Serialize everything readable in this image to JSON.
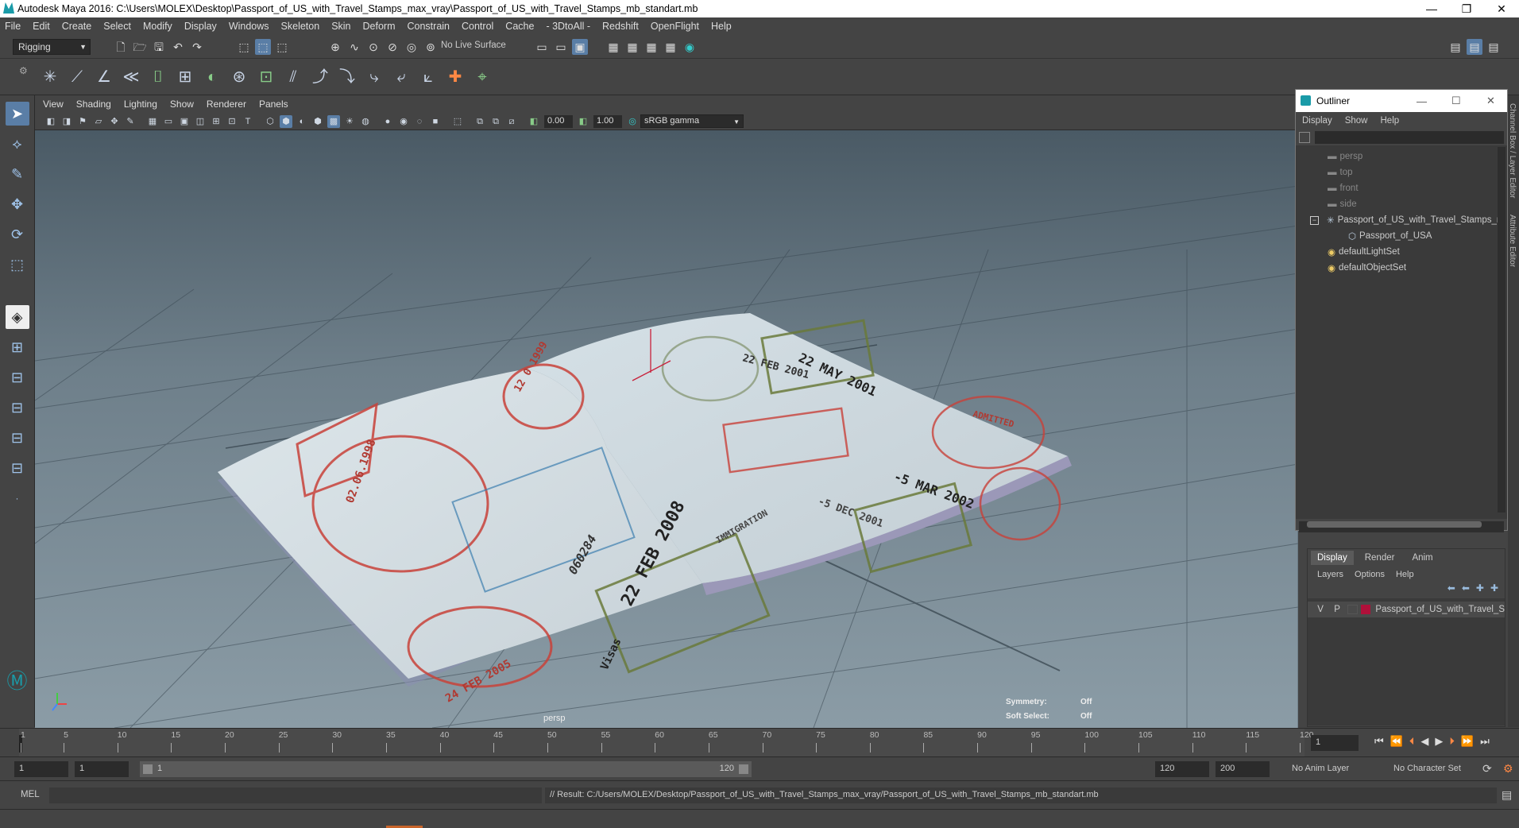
{
  "window": {
    "title": "Autodesk Maya 2016: C:\\Users\\MOLEX\\Desktop\\Passport_of_US_with_Travel_Stamps_max_vray\\Passport_of_US_with_Travel_Stamps_mb_standart.mb",
    "minimize": "—",
    "restore": "❐",
    "close": "✕"
  },
  "menubar": [
    "File",
    "Edit",
    "Create",
    "Select",
    "Modify",
    "Display",
    "Windows",
    "Skeleton",
    "Skin",
    "Deform",
    "Constrain",
    "Control",
    "Cache",
    "- 3DtoAll -",
    "Redshift",
    "OpenFlight",
    "Help"
  ],
  "statusline": {
    "menuset": "Rigging",
    "live_surface": "No Live Surface"
  },
  "viewport": {
    "menu": [
      "View",
      "Shading",
      "Lighting",
      "Show",
      "Renderer",
      "Panels"
    ],
    "exposure": "0.00",
    "gamma": "1.00",
    "colorspace": "sRGB gamma",
    "camera_label": "persp",
    "symmetry_label": "Symmetry:",
    "symmetry_value": "Off",
    "soft_select_label": "Soft Select:",
    "soft_select_value": "Off",
    "stamps": [
      "22 MAY 2001",
      "22 FEB 2001",
      "-5 MAR 2002",
      "-5 DEC 2001",
      "22 FEB 2008",
      "24 FEB 2005",
      "02.06.1998",
      "12 0 1999",
      "060284",
      "Visas",
      "IMMIGRATION",
      "ADMITTED"
    ]
  },
  "outliner": {
    "title": "Outliner",
    "menu": [
      "Display",
      "Show",
      "Help"
    ],
    "items": [
      {
        "label": "persp",
        "icon": "camera-icon",
        "dim": true,
        "indent": 0
      },
      {
        "label": "top",
        "icon": "camera-icon",
        "dim": true,
        "indent": 0
      },
      {
        "label": "front",
        "icon": "camera-icon",
        "dim": true,
        "indent": 0
      },
      {
        "label": "side",
        "icon": "camera-icon",
        "dim": true,
        "indent": 0
      },
      {
        "label": "Passport_of_US_with_Travel_Stamps_n",
        "icon": "joint-icon",
        "dim": false,
        "indent": 0
      },
      {
        "label": "Passport_of_USA",
        "icon": "mesh-icon",
        "dim": false,
        "indent": 1
      },
      {
        "label": "defaultLightSet",
        "icon": "set-icon",
        "dim": false,
        "indent": 0
      },
      {
        "label": "defaultObjectSet",
        "icon": "set-icon",
        "dim": false,
        "indent": 0
      }
    ]
  },
  "layer_editor": {
    "tabs": [
      "Display",
      "Render",
      "Anim"
    ],
    "menu": [
      "Layers",
      "Options",
      "Help"
    ],
    "layer": {
      "v": "V",
      "p": "P",
      "name": "Passport_of_US_with_Travel_S",
      "color": "#b0103a"
    }
  },
  "timeline": {
    "ticks": [
      "1",
      "5",
      "10",
      "15",
      "20",
      "25",
      "30",
      "35",
      "40",
      "45",
      "50",
      "55",
      "60",
      "65",
      "70",
      "75",
      "80",
      "85",
      "90",
      "95",
      "100",
      "105",
      "110",
      "115",
      "120"
    ],
    "current_frame": "1"
  },
  "range": {
    "start": "1",
    "anim_start": "1",
    "slider_start": "1",
    "slider_end": "120",
    "end": "120",
    "anim_end": "200",
    "anim_layer": "No Anim Layer",
    "character_set": "No Character Set"
  },
  "cmdline": {
    "mode": "MEL",
    "result": "// Result: C:/Users/MOLEX/Desktop/Passport_of_US_with_Travel_Stamps_max_vray/Passport_of_US_with_Travel_Stamps_mb_standart.mb"
  }
}
